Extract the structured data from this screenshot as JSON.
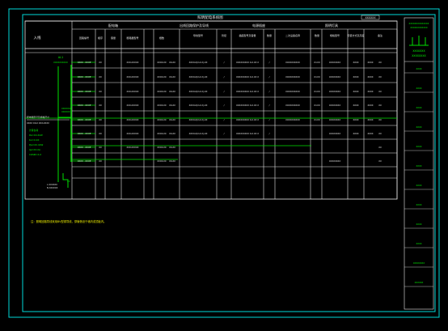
{
  "drawing": {
    "table_title": "照明配电系统图",
    "title_tag": "XXXXXX",
    "bottom_note": "注：照明回路导线采用BV型铜导线，穿管敷设于墙内或顶板内。",
    "colors": {
      "frame": "#00d8d8",
      "grid": "#e8e8e8",
      "circuit": "#00e000",
      "text_green": "#00ff00",
      "text_yellow": "#e8e800"
    },
    "header": {
      "inlet": "入线",
      "group_panel": "配电箱",
      "group_branch": "出线回路保护及导线",
      "group_distribution": "电源插座",
      "group_lighting": "照明灯具",
      "col_loop": "回路编号",
      "col_phase": "相序",
      "col_power": "容量",
      "col_breaker": "断路器型号",
      "col_wire_count": "根数",
      "col_wire": "导线型号",
      "col_pipe": "管径",
      "col_socket_type": "插座型号及容量",
      "col_socket_qty": "数量",
      "col_lamp_type": "灯具型号及容量",
      "col_lamp_qty": "数量",
      "col_dev_name": "二次设备名称",
      "col_dev_qty": "数量",
      "col_dev_spec": "规格型号",
      "col_dev_install": "安装方式及高度",
      "col_remark": "备注"
    },
    "left_panel": {
      "top_label": "AL1",
      "top_sub": "XXXXXXXXXX",
      "bus_label": "XXXXXXX",
      "bus_sub": "XXXXXX",
      "box_label": "配电箱型号及规格尺寸",
      "box_model": "XXXX XX-X XXX-XXXX",
      "calc": [
        "计算负荷",
        "Pe=XX.XkW",
        "Kx=X.XX",
        "Pjs=XX.XkW",
        "Ijs=XX.XA",
        "COSΦ=X.X"
      ],
      "bottom_label": "XX",
      "bottom_rows": [
        "L XXXXXX",
        "N XXXXXX"
      ]
    },
    "rows": [
      {
        "loop": "XXXX - XXXP",
        "ph": "XX",
        "pw": "XXX-XXXXX",
        "br": "XXXX-XX",
        "wc": "XX-XX",
        "wire": "XXXX-X(X-X.X)-XX",
        "pipe": "/",
        "sock": "XXXXXXXXX X-X.XX X",
        "sq": "/",
        "lamp": "XXXXXXXXXX",
        "lq": "X×XX",
        "dev": "XXXXXXXX",
        "dq": "XXXX",
        "spec": "XXXX",
        "rem": "XX"
      },
      {
        "loop": "XXXX - XXXP",
        "ph": "XX",
        "pw": "XXX-XXXXX",
        "br": "XXXX-XX",
        "wc": "XX-XX",
        "wire": "XXXX-X(X-X.X)-XX",
        "pipe": "/",
        "sock": "XXXXXXXXX X-X.XX X",
        "sq": "/",
        "lamp": "XXXXXXXXXX",
        "lq": "X×XX",
        "dev": "XXXXXXXX",
        "dq": "XXXX",
        "spec": "XXXX",
        "rem": "XX"
      },
      {
        "loop": "XXXX - XXXP",
        "ph": "XX",
        "pw": "XXX-XXXXX",
        "br": "XXXX-XX",
        "wc": "XX-XX",
        "wire": "XXXX-X(X-X.X)-XX",
        "pipe": "/",
        "sock": "XXXXXXXXX X-X.XX X",
        "sq": "/",
        "lamp": "XXXXXXXXXX",
        "lq": "X×XX",
        "dev": "XXXXXXXX",
        "dq": "XXXX",
        "spec": "XXXX",
        "rem": "XX"
      },
      {
        "loop": "XXXX - XXXP",
        "ph": "XX",
        "pw": "XXX-XXXXX",
        "br": "XXXX-XX",
        "wc": "XX-XX",
        "wire": "XXXX-X(X-X.X)-XX",
        "pipe": "/",
        "sock": "XXXXXXXXX X-X.XX X",
        "sq": "/",
        "lamp": "XXXXXXXXXX",
        "lq": "X×XX",
        "dev": "XXXXXXXX",
        "dq": "XXXX",
        "spec": "XXXX",
        "rem": "XX"
      },
      {
        "loop": "XXXX - XXXP",
        "ph": "XX",
        "pw": "XXX-XXXXX",
        "br": "XXXX-XX",
        "wc": "XX-XX",
        "wire": "XXXX-X(X-X.X)-XX",
        "pipe": "/",
        "sock": "XXXXXXXXX X-X.XX X",
        "sq": "/",
        "lamp": "XXXXXXXXXX",
        "lq": "X×XX",
        "dev": "XXXXXXXX",
        "dq": "XXXX",
        "spec": "XXXX",
        "rem": "XX"
      },
      {
        "loop": "XXXX - XXXP",
        "ph": "XX",
        "pw": "XXX-XXXXX",
        "br": "XXXX-XX",
        "wc": "XX-XX",
        "wire": "XXXX-X(X-X.X)-XX",
        "pipe": "/",
        "sock": "XXXXXXXXX X-X.XX X",
        "sq": "/",
        "lamp": "",
        "lq": "",
        "dev": "XXXXXXXX",
        "dq": "XXXX",
        "spec": "XXXX",
        "rem": "XX"
      },
      {
        "loop": "XXXX - XXXP",
        "ph": "XX",
        "pw": "XXX-XXXXX",
        "br": "XXXX-XX",
        "wc": "XX-XX",
        "wire": "",
        "pipe": "",
        "sock": "",
        "sq": "",
        "lamp": "",
        "lq": "",
        "dev": "",
        "dq": "",
        "spec": "",
        "rem": "XX"
      },
      {
        "loop": "XXXX - XXXP",
        "ph": "XX",
        "pw": "",
        "br": "XXXX-XX",
        "wc": "XX-XX",
        "wire": "",
        "pipe": "",
        "sock": "",
        "sq": "",
        "lamp": "",
        "lq": "",
        "dev": "XXXXXXXX",
        "dq": "",
        "spec": "",
        "rem": "XX"
      }
    ],
    "title_block": {
      "top_lines": [
        "XXXXXXXXXXXXXX",
        "XXXXXXXXXXXX"
      ],
      "company": [
        "XXXXXXX",
        "XXXXXXXX"
      ],
      "fields": [
        "XXXX",
        "XXXX",
        "XXXX",
        "XXXX",
        "XXXX",
        "XXXX",
        "XXXX",
        "XXXX",
        "XXXX",
        "XXXX",
        "XXXXXXXX",
        "XXXXXX"
      ]
    }
  }
}
